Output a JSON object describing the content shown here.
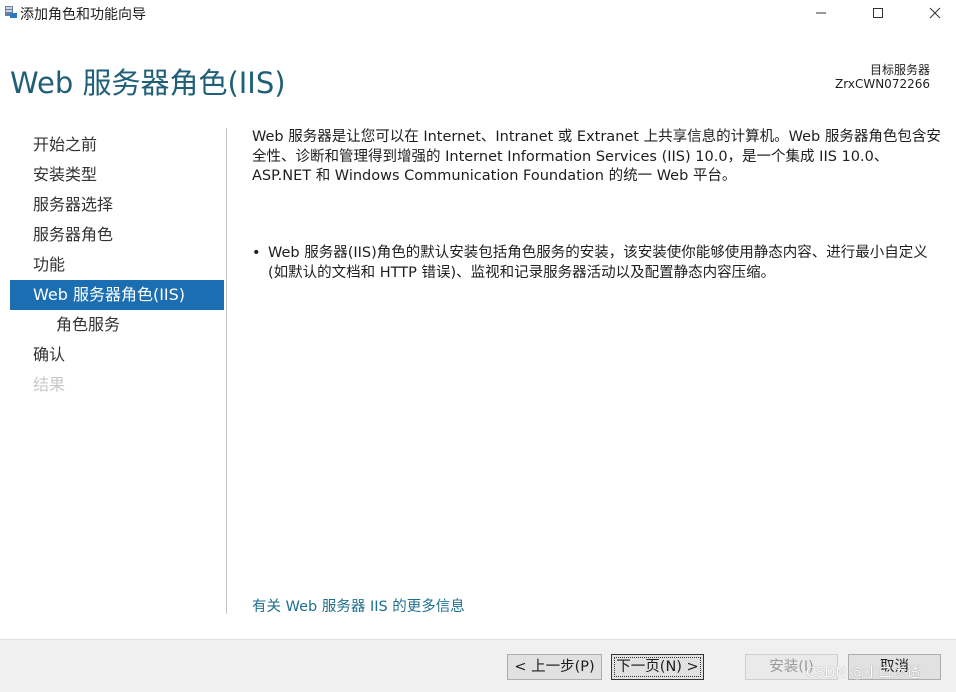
{
  "window": {
    "title": "添加角色和功能向导",
    "icons": {
      "app": "server-manager-icon",
      "minimize": "minimize-icon",
      "maximize": "maximize-icon",
      "close": "close-icon"
    }
  },
  "header": {
    "title": "Web 服务器角色(IIS)",
    "target_label": "目标服务器",
    "target_name": "ZrxCWN072266"
  },
  "nav": {
    "items": [
      {
        "label": "开始之前"
      },
      {
        "label": "安装类型"
      },
      {
        "label": "服务器选择"
      },
      {
        "label": "服务器角色"
      },
      {
        "label": "功能"
      },
      {
        "label": "Web 服务器角色(IIS)"
      },
      {
        "label": "角色服务"
      },
      {
        "label": "确认"
      },
      {
        "label": "结果"
      }
    ]
  },
  "content": {
    "description": "Web 服务器是让您可以在 Internet、Intranet 或 Extranet 上共享信息的计算机。Web 服务器角色包含安全性、诊断和管理得到增强的 Internet Information Services (IIS) 10.0，是一个集成 IIS 10.0、ASP.NET 和 Windows Communication Foundation 的统一 Web 平台。",
    "bullet_mark": "•",
    "bullet": "Web 服务器(IIS)角色的默认安装包括角色服务的安装，该安装使你能够使用静态内容、进行最小自定义(如默认的文档和 HTTP 错误)、监视和记录服务器活动以及配置静态内容压缩。",
    "more_info_link": "有关 Web 服务器 IIS 的更多信息"
  },
  "footer": {
    "prev_label": "< 上一步(P)",
    "next_label": "下一页(N) >",
    "install_label": "安装(I)",
    "cancel_label": "取消"
  },
  "watermark": "CSDN @小白渗透",
  "colors": {
    "accent": "#1b6eb2",
    "header": "#1f5f78",
    "link": "#1e6f8f"
  }
}
